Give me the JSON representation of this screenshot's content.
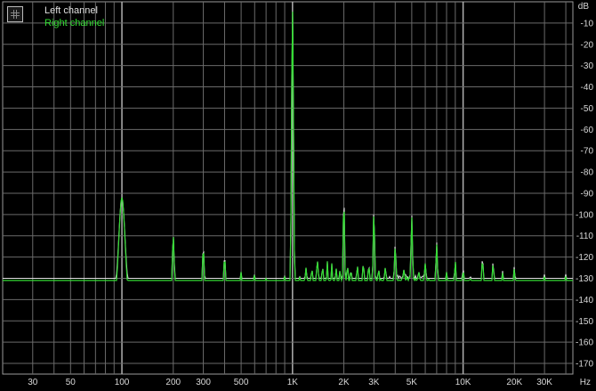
{
  "chart_data": {
    "type": "line",
    "xlabel": "",
    "ylabel": "",
    "x_scale": "log",
    "x_unit": "Hz",
    "y_unit": "dB",
    "xlim": [
      20,
      44000
    ],
    "ylim": [
      -175,
      0
    ],
    "grid": true,
    "legend": "top-left",
    "x_tick_labels": [
      {
        "label": "30",
        "value": 30
      },
      {
        "label": "50",
        "value": 50
      },
      {
        "label": "100",
        "value": 100
      },
      {
        "label": "200",
        "value": 200
      },
      {
        "label": "300",
        "value": 300
      },
      {
        "label": "500",
        "value": 500
      },
      {
        "label": "1K",
        "value": 1000
      },
      {
        "label": "2K",
        "value": 2000
      },
      {
        "label": "3K",
        "value": 3000
      },
      {
        "label": "5K",
        "value": 5000
      },
      {
        "label": "10K",
        "value": 10000
      },
      {
        "label": "20K",
        "value": 20000
      },
      {
        "label": "30K",
        "value": 30000
      }
    ],
    "y_ticks": [
      -10,
      -20,
      -30,
      -40,
      -50,
      -60,
      -70,
      -80,
      -90,
      -100,
      -110,
      -120,
      -130,
      -140,
      -150,
      -160,
      -170
    ],
    "series": [
      {
        "name": "Left channel",
        "color": "#e0e0e0",
        "noise_floor": [
          [
            20,
            -138
          ],
          [
            80,
            -138
          ],
          [
            100,
            -138
          ],
          [
            200,
            -139
          ],
          [
            500,
            -139
          ],
          [
            900,
            -140
          ],
          [
            1300,
            -137
          ],
          [
            2000,
            -134
          ],
          [
            3500,
            -131
          ],
          [
            5000,
            -130
          ],
          [
            6000,
            -131
          ],
          [
            8000,
            -133
          ],
          [
            10000,
            -135
          ],
          [
            15000,
            -139
          ],
          [
            20000,
            -142
          ],
          [
            30000,
            -145
          ],
          [
            44000,
            -147
          ]
        ],
        "peaks": [
          [
            100,
            -92
          ],
          [
            200,
            -110
          ],
          [
            300,
            -116
          ],
          [
            400,
            -120
          ],
          [
            500,
            -127
          ],
          [
            600,
            -128
          ],
          [
            700,
            -130
          ],
          [
            800,
            -131
          ],
          [
            900,
            -129
          ],
          [
            1000,
            -3
          ],
          [
            1100,
            -129
          ],
          [
            1200,
            -125
          ],
          [
            1300,
            -126
          ],
          [
            1400,
            -122
          ],
          [
            1500,
            -124
          ],
          [
            1600,
            -122
          ],
          [
            1700,
            -123
          ],
          [
            1800,
            -125
          ],
          [
            1900,
            -126
          ],
          [
            2000,
            -90
          ],
          [
            2100,
            -124
          ],
          [
            2200,
            -126
          ],
          [
            2400,
            -124
          ],
          [
            2600,
            -123
          ],
          [
            2800,
            -124
          ],
          [
            3000,
            -97
          ],
          [
            3200,
            -126
          ],
          [
            3500,
            -125
          ],
          [
            4000,
            -114
          ],
          [
            4500,
            -126
          ],
          [
            5000,
            -100
          ],
          [
            5500,
            -127
          ],
          [
            6000,
            -123
          ],
          [
            7000,
            -113
          ],
          [
            8000,
            -127
          ],
          [
            9000,
            -122
          ],
          [
            10000,
            -125
          ],
          [
            11000,
            -128
          ],
          [
            13000,
            -119
          ],
          [
            15000,
            -121
          ],
          [
            17000,
            -126
          ],
          [
            20000,
            -123
          ],
          [
            23000,
            -134
          ],
          [
            27000,
            -134
          ],
          [
            30000,
            -128
          ],
          [
            33000,
            -130
          ],
          [
            37000,
            -132
          ],
          [
            40000,
            -128
          ],
          [
            42000,
            -130
          ]
        ]
      },
      {
        "name": "Right channel",
        "color": "#33dd33",
        "noise_floor": [
          [
            20,
            -142
          ],
          [
            50,
            -142
          ],
          [
            70,
            -142
          ],
          [
            100,
            -142
          ],
          [
            200,
            -145
          ],
          [
            300,
            -146
          ],
          [
            500,
            -147
          ],
          [
            900,
            -146
          ],
          [
            1300,
            -138
          ],
          [
            2000,
            -135
          ],
          [
            3500,
            -132
          ],
          [
            5000,
            -131
          ],
          [
            6000,
            -132
          ],
          [
            8000,
            -134
          ],
          [
            10000,
            -136
          ],
          [
            15000,
            -140
          ],
          [
            20000,
            -143
          ],
          [
            30000,
            -146
          ],
          [
            44000,
            -148
          ]
        ],
        "peaks": [
          [
            100,
            -92
          ],
          [
            200,
            -110
          ],
          [
            300,
            -116
          ],
          [
            400,
            -120
          ],
          [
            500,
            -127
          ],
          [
            600,
            -128
          ],
          [
            700,
            -130
          ],
          [
            800,
            -131
          ],
          [
            900,
            -129
          ],
          [
            1000,
            -3
          ],
          [
            1100,
            -129
          ],
          [
            1200,
            -125
          ],
          [
            1300,
            -126
          ],
          [
            1400,
            -122
          ],
          [
            1500,
            -124
          ],
          [
            1600,
            -122
          ],
          [
            1700,
            -123
          ],
          [
            1800,
            -125
          ],
          [
            1900,
            -126
          ],
          [
            2000,
            -92
          ],
          [
            2100,
            -124
          ],
          [
            2200,
            -126
          ],
          [
            2400,
            -124
          ],
          [
            2600,
            -123
          ],
          [
            2800,
            -124
          ],
          [
            3000,
            -98
          ],
          [
            3200,
            -126
          ],
          [
            3500,
            -125
          ],
          [
            4000,
            -115
          ],
          [
            4500,
            -126
          ],
          [
            5000,
            -101
          ],
          [
            5500,
            -127
          ],
          [
            6000,
            -123
          ],
          [
            7000,
            -114
          ],
          [
            8000,
            -127
          ],
          [
            9000,
            -122
          ],
          [
            10000,
            -126
          ],
          [
            11000,
            -129
          ],
          [
            13000,
            -120
          ],
          [
            15000,
            -122
          ],
          [
            17000,
            -127
          ],
          [
            20000,
            -124
          ],
          [
            23000,
            -134
          ],
          [
            27000,
            -135
          ],
          [
            30000,
            -129
          ],
          [
            33000,
            -131
          ],
          [
            37000,
            -133
          ],
          [
            40000,
            -129
          ],
          [
            42000,
            -131
          ]
        ]
      }
    ]
  }
}
